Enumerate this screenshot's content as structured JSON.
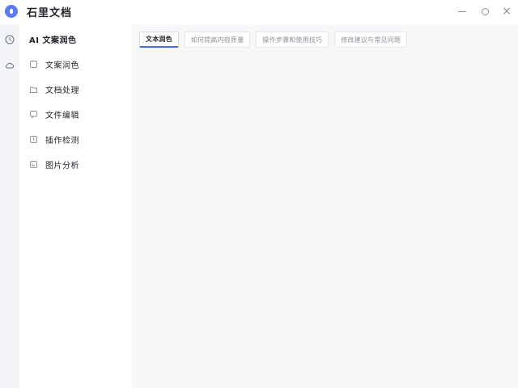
{
  "app": {
    "title": "石里文档",
    "logo_icon": "app-logo-icon",
    "accent_color": "#4a6cf0"
  },
  "window_controls": {
    "minimize_icon": "minimize-icon",
    "maximize_icon": "maximize-icon",
    "close_icon": "close-icon",
    "close_glyph": "×"
  },
  "rail": {
    "items": [
      {
        "icon": "history-icon"
      },
      {
        "icon": "cloud-icon"
      }
    ]
  },
  "sidebar": {
    "header": "AI 文案润色",
    "items": [
      {
        "label": "文案润色",
        "icon": "square-icon"
      },
      {
        "label": "文档处理",
        "icon": "folder-icon"
      },
      {
        "label": "文件编辑",
        "icon": "chat-icon"
      },
      {
        "label": "插作检测",
        "icon": "clock-icon"
      },
      {
        "label": "图片分析",
        "icon": "image-icon"
      }
    ]
  },
  "main": {
    "tabs": [
      {
        "label": "文本润色",
        "active": true
      },
      {
        "label": "如何提高内容质量",
        "active": false
      },
      {
        "label": "操作步骤和使用技巧",
        "active": false
      },
      {
        "label": "修改建议与常见问题",
        "active": false
      }
    ]
  }
}
